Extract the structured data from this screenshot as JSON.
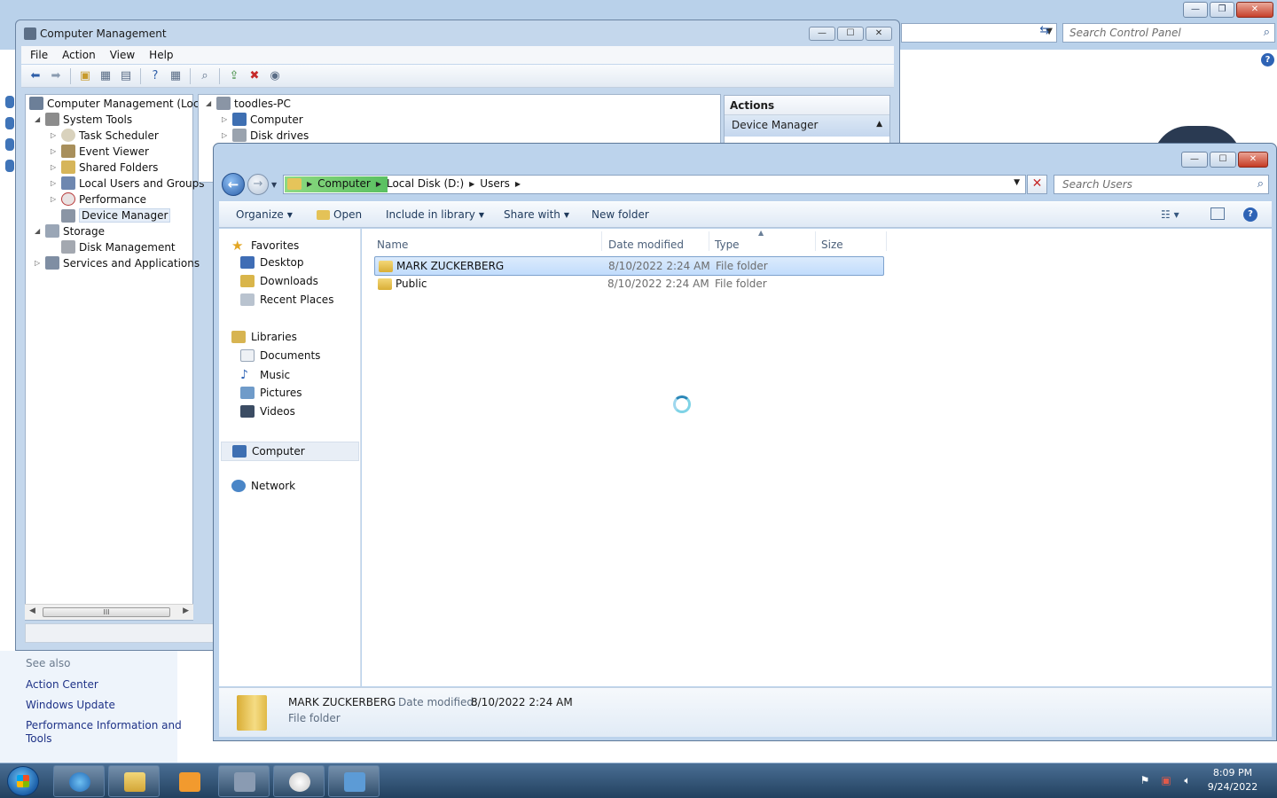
{
  "control_panel": {
    "search_placeholder": "Search Control Panel",
    "see_also_label": "See also",
    "links": [
      "Action Center",
      "Windows Update",
      "Performance Information and",
      "Tools"
    ]
  },
  "computer_management": {
    "title": "Computer Management",
    "menu": [
      "File",
      "Action",
      "View",
      "Help"
    ],
    "tree": [
      {
        "label": "Computer Management (Local"
      },
      {
        "label": "System Tools"
      },
      {
        "label": "Task Scheduler"
      },
      {
        "label": "Event Viewer"
      },
      {
        "label": "Shared Folders"
      },
      {
        "label": "Local Users and Groups"
      },
      {
        "label": "Performance"
      },
      {
        "label": "Device Manager"
      },
      {
        "label": "Storage"
      },
      {
        "label": "Disk Management"
      },
      {
        "label": "Services and Applications"
      }
    ],
    "middle_tree": [
      "toodles-PC",
      "Computer",
      "Disk drives"
    ],
    "actions_header": "Actions",
    "actions_selected": "Device Manager",
    "hscroll_grip": "III"
  },
  "explorer": {
    "breadcrumbs": [
      "Computer",
      "Local Disk (D:)",
      "Users"
    ],
    "search_placeholder": "Search Users",
    "commands": {
      "organize": "Organize",
      "open": "Open",
      "include": "Include in library",
      "share": "Share with",
      "new_folder": "New folder"
    },
    "nav": {
      "favorites": "Favorites",
      "desktop": "Desktop",
      "downloads": "Downloads",
      "recent": "Recent Places",
      "libraries": "Libraries",
      "documents": "Documents",
      "music": "Music",
      "pictures": "Pictures",
      "videos": "Videos",
      "computer": "Computer",
      "network": "Network"
    },
    "columns": {
      "name": "Name",
      "date": "Date modified",
      "type": "Type",
      "size": "Size"
    },
    "files": [
      {
        "name": "MARK ZUCKERBERG",
        "date": "8/10/2022 2:24 AM",
        "type": "File folder"
      },
      {
        "name": "Public",
        "date": "8/10/2022 2:24 AM",
        "type": "File folder"
      }
    ],
    "details": {
      "name": "MARK ZUCKERBERG",
      "date_label": "Date modified:",
      "date_value": "8/10/2022 2:24 AM",
      "type": "File folder"
    }
  },
  "taskbar": {
    "time": "8:09 PM",
    "date": "9/24/2022"
  },
  "colors": {
    "accent": "#2e63b5",
    "selection": "#c1dcfc",
    "taskbar": "#22415f"
  }
}
